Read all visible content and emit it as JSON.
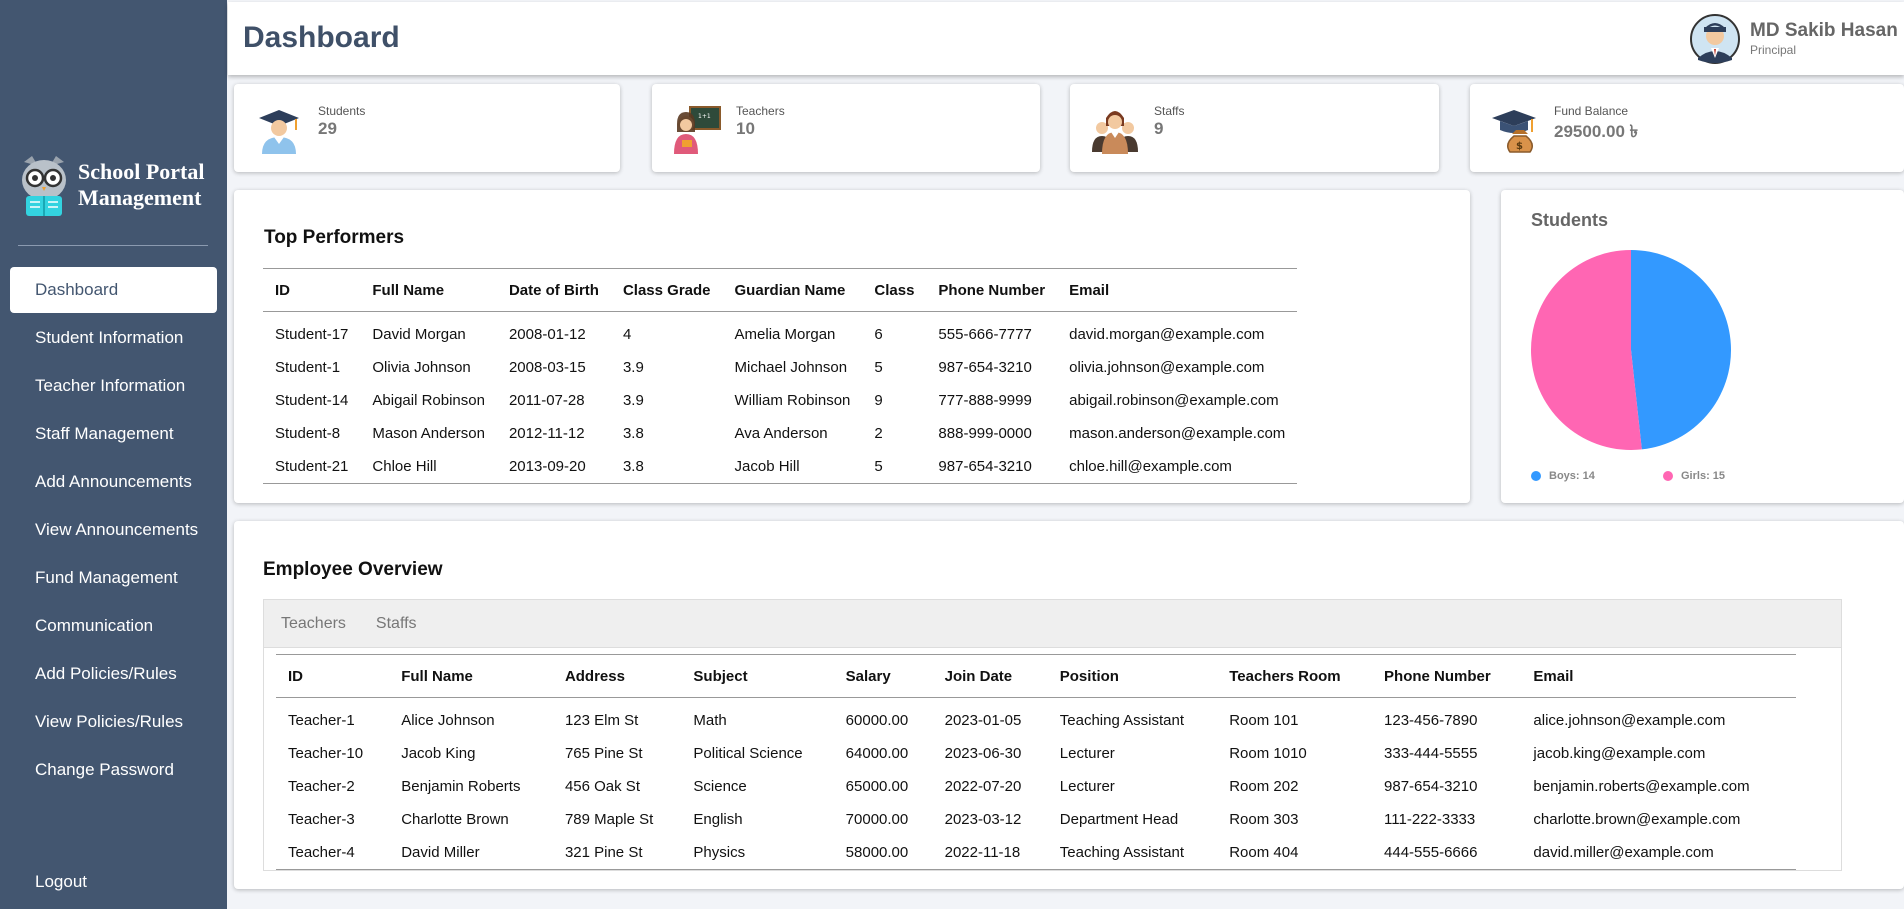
{
  "app": {
    "title_line1": "School Portal",
    "title_line2": "Management"
  },
  "sidebar": {
    "items": [
      {
        "label": "Dashboard"
      },
      {
        "label": "Student Information"
      },
      {
        "label": "Teacher Information"
      },
      {
        "label": "Staff Management"
      },
      {
        "label": "Add Announcements"
      },
      {
        "label": "View Announcements"
      },
      {
        "label": "Fund Management"
      },
      {
        "label": "Communication"
      },
      {
        "label": "Add Policies/Rules"
      },
      {
        "label": "View Policies/Rules"
      },
      {
        "label": "Change Password"
      }
    ],
    "active_index": 0,
    "logout": "Logout"
  },
  "header": {
    "title": "Dashboard",
    "user_name": "MD Sakib Hasan",
    "user_role": "Principal"
  },
  "stats": [
    {
      "label": "Students",
      "value": "29",
      "icon": "graduate-student-icon"
    },
    {
      "label": "Teachers",
      "value": "10",
      "icon": "teacher-icon"
    },
    {
      "label": "Staffs",
      "value": "9",
      "icon": "staff-group-icon"
    },
    {
      "label": "Fund Balance",
      "value": "29500.00 ৳",
      "icon": "money-bag-icon"
    }
  ],
  "top_performers": {
    "title": "Top Performers",
    "columns": [
      "ID",
      "Full Name",
      "Date of Birth",
      "Class Grade",
      "Guardian Name",
      "Class",
      "Phone Number",
      "Email"
    ],
    "rows": [
      [
        "Student-17",
        "David Morgan",
        "2008-01-12",
        "4",
        "Amelia Morgan",
        "6",
        "555-666-7777",
        "david.morgan@example.com"
      ],
      [
        "Student-1",
        "Olivia Johnson",
        "2008-03-15",
        "3.9",
        "Michael Johnson",
        "5",
        "987-654-3210",
        "olivia.johnson@example.com"
      ],
      [
        "Student-14",
        "Abigail Robinson",
        "2011-07-28",
        "3.9",
        "William Robinson",
        "9",
        "777-888-9999",
        "abigail.robinson@example.com"
      ],
      [
        "Student-8",
        "Mason Anderson",
        "2012-11-12",
        "3.8",
        "Ava Anderson",
        "2",
        "888-999-0000",
        "mason.anderson@example.com"
      ],
      [
        "Student-21",
        "Chloe Hill",
        "2013-09-20",
        "3.8",
        "Jacob Hill",
        "5",
        "987-654-3210",
        "chloe.hill@example.com"
      ]
    ]
  },
  "students_chart": {
    "title": "Students",
    "colors": {
      "boys": "#3399ff",
      "girls": "#ff66b3"
    },
    "legend_boys": "Boys: 14",
    "legend_girls": "Girls: 15"
  },
  "chart_data": {
    "type": "pie",
    "title": "Students",
    "categories": [
      "Boys",
      "Girls"
    ],
    "values": [
      14,
      15
    ],
    "colors": [
      "#3399ff",
      "#ff66b3"
    ],
    "legend_position": "bottom"
  },
  "employee_overview": {
    "title": "Employee Overview",
    "tabs": [
      "Teachers",
      "Staffs"
    ],
    "columns": [
      "ID",
      "Full Name",
      "Address",
      "Subject",
      "Salary",
      "Join Date",
      "Position",
      "Teachers Room",
      "Phone Number",
      "Email"
    ],
    "rows": [
      [
        "Teacher-1",
        "Alice Johnson",
        "123 Elm St",
        "Math",
        "60000.00",
        "2023-01-05",
        "Teaching Assistant",
        "Room 101",
        "123-456-7890",
        "alice.johnson@example.com"
      ],
      [
        "Teacher-10",
        "Jacob King",
        "765 Pine St",
        "Political Science",
        "64000.00",
        "2023-06-30",
        "Lecturer",
        "Room 1010",
        "333-444-5555",
        "jacob.king@example.com"
      ],
      [
        "Teacher-2",
        "Benjamin Roberts",
        "456 Oak St",
        "Science",
        "65000.00",
        "2022-07-20",
        "Lecturer",
        "Room 202",
        "987-654-3210",
        "benjamin.roberts@example.com"
      ],
      [
        "Teacher-3",
        "Charlotte Brown",
        "789 Maple St",
        "English",
        "70000.00",
        "2023-03-12",
        "Department Head",
        "Room 303",
        "111-222-3333",
        "charlotte.brown@example.com"
      ],
      [
        "Teacher-4",
        "David Miller",
        "321 Pine St",
        "Physics",
        "58000.00",
        "2022-11-18",
        "Teaching Assistant",
        "Room 404",
        "444-555-6666",
        "david.miller@example.com"
      ]
    ]
  }
}
